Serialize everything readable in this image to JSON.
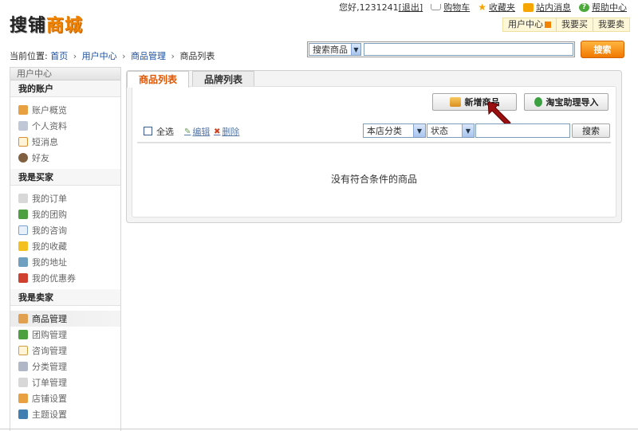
{
  "logo": {
    "part1": "搜铺",
    "part2": "商城"
  },
  "topbar": {
    "welcome": "您好,1231241",
    "logout": "[退出]",
    "cart": "购物车",
    "favorites": "收藏夹",
    "messages": "站内消息",
    "help": "帮助中心"
  },
  "userbar": {
    "center": "用户中心",
    "want_buy": "我要买",
    "want_sell": "我要卖"
  },
  "breadcrumb": {
    "prefix": "当前位置:",
    "home": "首页",
    "user_center": "用户中心",
    "goods_manage": "商品管理",
    "current": "商品列表",
    "sep": "›"
  },
  "search": {
    "type": "搜索商品",
    "button": "搜索",
    "value": ""
  },
  "sidebar": {
    "title": "用户中心",
    "sections": [
      {
        "title": "我的账户",
        "items": [
          "账户概览",
          "个人资料",
          "短消息",
          "好友"
        ]
      },
      {
        "title": "我是买家",
        "items": [
          "我的订单",
          "我的团购",
          "我的咨询",
          "我的收藏",
          "我的地址",
          "我的优惠券"
        ]
      },
      {
        "title": "我是卖家",
        "items": [
          "商品管理",
          "团购管理",
          "咨询管理",
          "分类管理",
          "订单管理",
          "店铺设置",
          "主题设置"
        ]
      }
    ]
  },
  "tabs": [
    "商品列表",
    "品牌列表"
  ],
  "actions": {
    "add_goods": "新增商品",
    "taobao_import": "淘宝助理导入"
  },
  "toolbar": {
    "select_all": "全选",
    "edit": "编辑",
    "delete": "删除",
    "category": "本店分类",
    "status": "状态",
    "search_button": "搜索",
    "keyword": ""
  },
  "empty_message": "没有符合条件的商品",
  "colors": {
    "accent": "#f08300",
    "link": "#1d4fa0",
    "active_tab": "#e05500"
  }
}
